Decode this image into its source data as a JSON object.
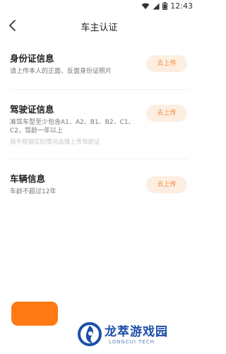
{
  "status_bar": {
    "time": "12:43"
  },
  "header": {
    "title": "车主认证"
  },
  "sections": [
    {
      "title": "身份证信息",
      "desc": "请上传本人的正面、反面身份证照片",
      "button": "去上传"
    },
    {
      "title": "驾驶证信息",
      "desc_line1": "准驾车型至少包含A1、A2、B1、B2、C1、",
      "desc_line2": "C2，驾龄一年以上",
      "note": "骑手根据实际情况选择上传驾驶证",
      "button": "去上传"
    },
    {
      "title": "车辆信息",
      "desc": "车龄不超过12年",
      "button": "去上传"
    }
  ],
  "watermark": {
    "name": "龙萃游戏园",
    "sub": "LONGCUI TECH"
  },
  "colors": {
    "accent": "#ff7a14",
    "button_bg": "#fdeee2",
    "button_text": "#f08a3a",
    "brand_blue": "#1d4fa8"
  }
}
